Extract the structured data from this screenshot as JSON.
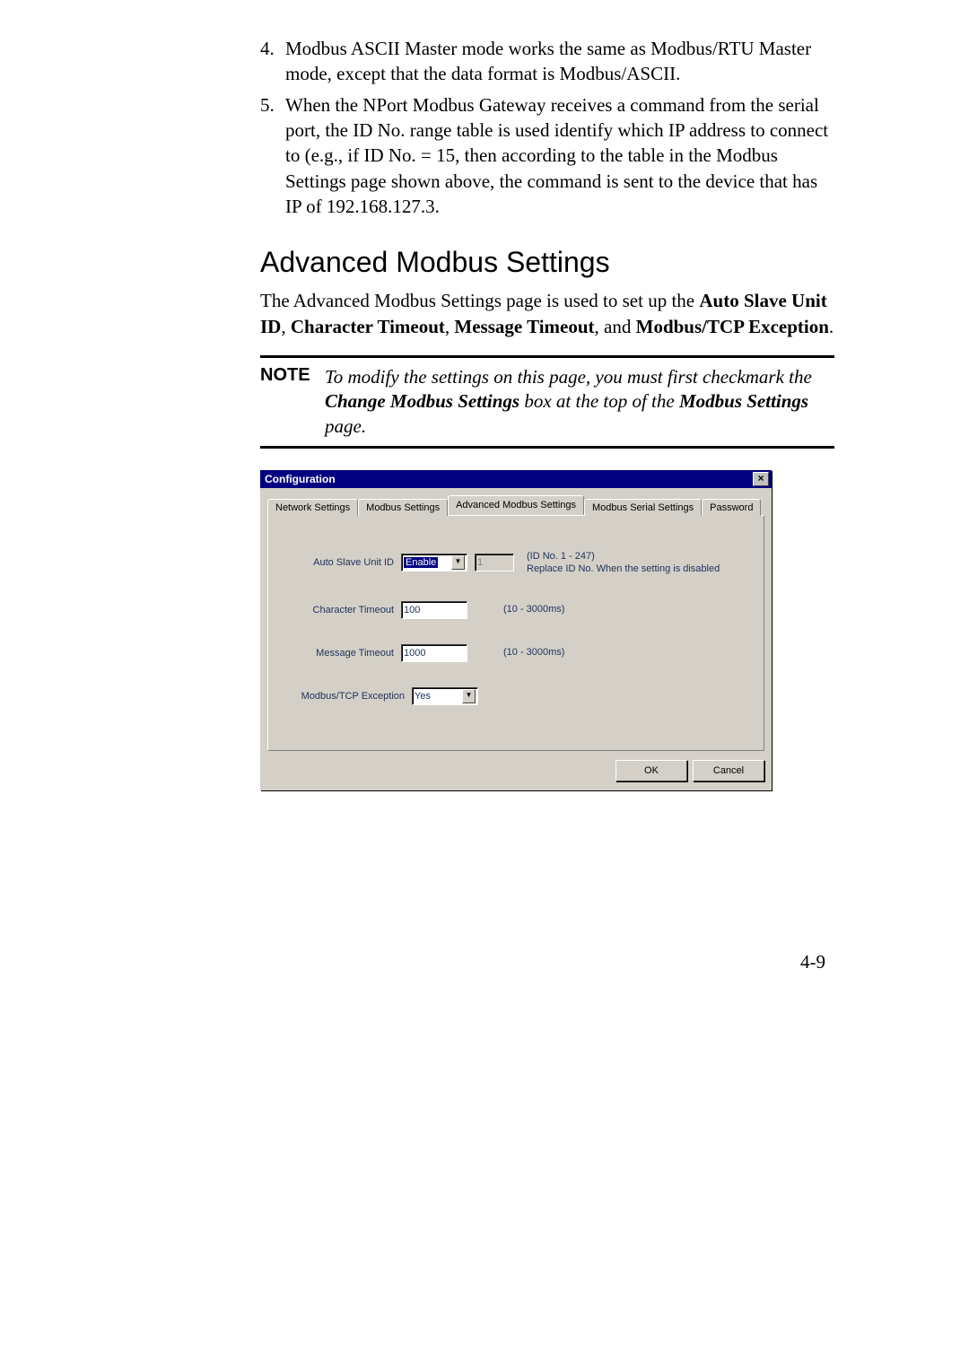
{
  "list": {
    "items": [
      {
        "num": "4.",
        "text": "Modbus ASCII Master mode works the same as Modbus/RTU Master mode, except that the data format is Modbus/ASCII."
      },
      {
        "num": "5.",
        "text": "When the NPort Modbus Gateway receives a command from the serial port, the ID No. range table is used identify which IP address to connect to (e.g., if ID No. = 15, then according to the table in the Modbus Settings page shown above, the command is sent to the device that has IP of 192.168.127.3."
      }
    ]
  },
  "heading": "Advanced Modbus Settings",
  "intro": {
    "pre": "The Advanced Modbus Settings page is used to set up the ",
    "b1": "Auto Slave Unit ID",
    "sep1": ", ",
    "b2": "Character Timeout",
    "sep2": ", ",
    "b3": "Message Timeout",
    "sep3": ", and ",
    "b4": "Modbus/TCP Exception",
    "end": "."
  },
  "note": {
    "label": "NOTE",
    "t1": "To modify the settings on this page, you must first checkmark the ",
    "bi1": "Change Modbus Settings",
    "t2": " box at the top of the ",
    "bi2": "Modbus Settings",
    "t3": " page."
  },
  "dialog": {
    "title": "Configuration",
    "close": "×",
    "tabs": {
      "t0": "Network Settings",
      "t1": "Modbus Settings",
      "t2": "Advanced Modbus Settings",
      "t3": "Modbus Serial Settings",
      "t4": "Password"
    },
    "fields": {
      "auto_slave": {
        "label": "Auto Slave Unit ID",
        "value": "Enable",
        "id_value": "1",
        "hint1": "(ID No. 1 - 247)",
        "hint2": "Replace ID No. When the setting is disabled"
      },
      "char_timeout": {
        "label": "Character Timeout",
        "value": "100",
        "hint": "(10 - 3000ms)"
      },
      "msg_timeout": {
        "label": "Message Timeout",
        "value": "1000",
        "hint": "(10 - 3000ms)"
      },
      "exception": {
        "label": "Modbus/TCP Exception",
        "value": "Yes"
      }
    },
    "buttons": {
      "ok": "OK",
      "cancel": "Cancel"
    }
  },
  "pagenum": "4-9"
}
